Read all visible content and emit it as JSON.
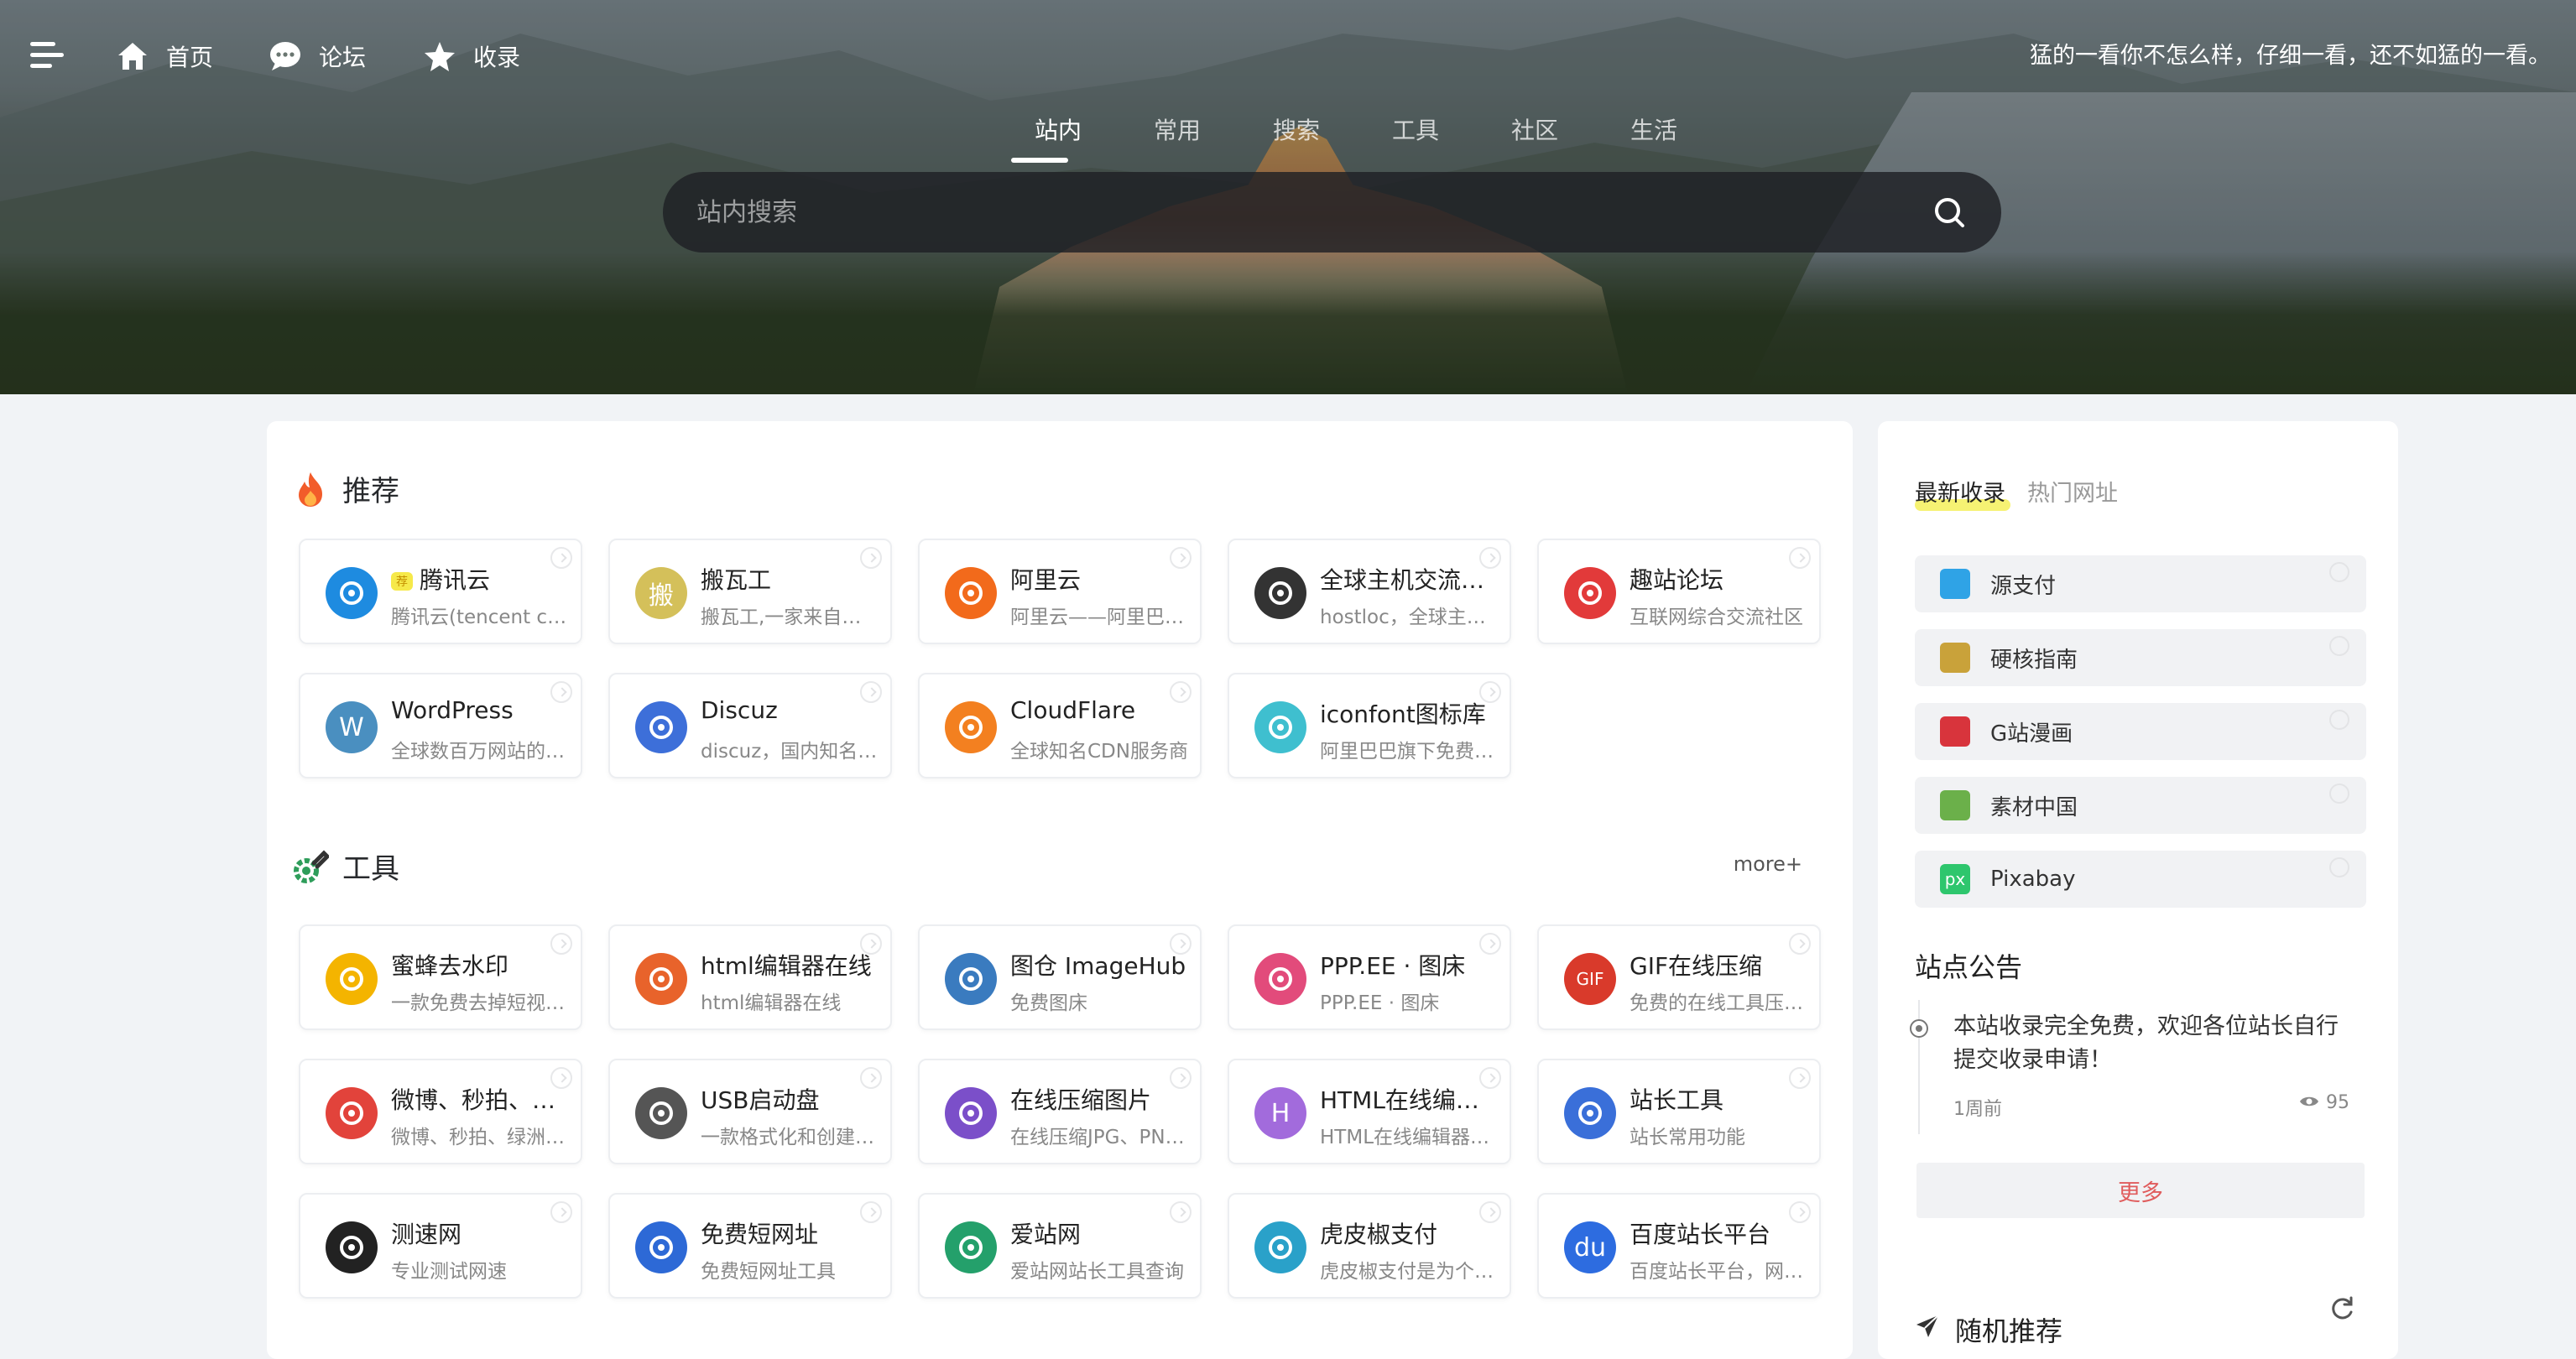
{
  "topnav": {
    "items": [
      {
        "label": "首页",
        "icon": "home-icon"
      },
      {
        "label": "论坛",
        "icon": "chat-icon"
      },
      {
        "label": "收录",
        "icon": "star-icon"
      }
    ],
    "motto": "猛的一看你不怎么样，仔细一看，还不如猛的一看。"
  },
  "search": {
    "tabs": [
      "站内",
      "常用",
      "搜索",
      "工具",
      "社区",
      "生活"
    ],
    "active_tab": "站内",
    "placeholder": "站内搜索"
  },
  "recommend": {
    "title": "推荐",
    "cards": [
      {
        "title": "腾讯云",
        "desc": "腾讯云(tencent cloud)",
        "badge": "荐",
        "icon": "cloud-icon",
        "color": "#1e8be0"
      },
      {
        "title": "搬瓦工",
        "desc": "搬瓦工,一家来自美国的VPS",
        "badge": "",
        "icon": "bwg-icon",
        "glyph": "搬",
        "color": "#d4c05a"
      },
      {
        "title": "阿里云",
        "desc": "阿里云——阿里巴巴集团",
        "badge": "",
        "icon": "aliyun-icon",
        "color": "#f26a1b"
      },
      {
        "title": "全球主机交流论坛",
        "desc": "hostloc，全球主机交流",
        "badge": "",
        "icon": "hostloc-icon",
        "color": "#333333"
      },
      {
        "title": "趣站论坛",
        "desc": "互联网综合交流社区",
        "badge": "",
        "icon": "quzhan-icon",
        "color": "#e23a3a"
      },
      {
        "title": "WordPress",
        "desc": "全球数百万网站的选择",
        "badge": "",
        "icon": "wordpress-icon",
        "glyph": "W",
        "color": "#4a8fc0"
      },
      {
        "title": "Discuz",
        "desc": "discuz，国内知名论坛",
        "badge": "",
        "icon": "discuz-icon",
        "color": "#3d6fd9"
      },
      {
        "title": "CloudFlare",
        "desc": "全球知名CDN服务商",
        "badge": "",
        "icon": "cloudflare-icon",
        "color": "#f38020"
      },
      {
        "title": "iconfont图标库",
        "desc": "阿里巴巴旗下免费图标库",
        "badge": "",
        "icon": "iconfont-icon",
        "color": "#3fbfcf"
      }
    ]
  },
  "tools": {
    "title": "工具",
    "more": "more+",
    "cards": [
      {
        "title": "蜜蜂去水印",
        "desc": "一款免费去掉短视频水印",
        "icon": "bee-icon",
        "color": "#f4b400"
      },
      {
        "title": "html编辑器在线",
        "desc": "html编辑器在线",
        "icon": "html-editor-icon",
        "color": "#e8632b"
      },
      {
        "title": "图仓 ImageHub",
        "desc": "免费图床",
        "icon": "image-icon",
        "color": "#3a7bbf"
      },
      {
        "title": "PPP.EE · 图床",
        "desc": "PPP.EE · 图床",
        "icon": "pinwheel-icon",
        "color": "#e24b7b"
      },
      {
        "title": "GIF在线压缩",
        "desc": "免费的在线工具压缩GIF",
        "icon": "gif-icon",
        "glyph": "GIF",
        "color": "#d93a2b"
      },
      {
        "title": "微博、秒拍、绿洲",
        "desc": "微博、秒拍、绿洲视频下载",
        "icon": "download-icon",
        "color": "#e2433b"
      },
      {
        "title": "USB启动盘",
        "desc": "一款格式化和创建启动盘",
        "icon": "usb-icon",
        "color": "#555555"
      },
      {
        "title": "在线压缩图片",
        "desc": "在线压缩JPG、PNG图片",
        "icon": "compress-icon",
        "color": "#7b4fc9"
      },
      {
        "title": "HTML在线编辑器",
        "desc": "HTML在线编辑器工具",
        "icon": "h-icon",
        "glyph": "H",
        "color": "#a26bdc"
      },
      {
        "title": "站长工具",
        "desc": "站长常用功能",
        "icon": "webmaster-icon",
        "color": "#3a6fd9"
      },
      {
        "title": "测速网",
        "desc": "专业测试网速",
        "icon": "speedometer-icon",
        "color": "#222222"
      },
      {
        "title": "免费短网址",
        "desc": "免费短网址工具",
        "icon": "shorturl-icon",
        "color": "#2d69d6"
      },
      {
        "title": "爱站网",
        "desc": "爱站网站长工具查询",
        "icon": "aizhan-icon",
        "color": "#24a06b"
      },
      {
        "title": "虎皮椒支付",
        "desc": "虎皮椒支付是为个人开发者",
        "icon": "hupijiao-icon",
        "color": "#2aa1c9"
      },
      {
        "title": "百度站长平台",
        "desc": "百度站长平台，网站优化",
        "icon": "baidu-icon",
        "glyph": "du",
        "color": "#2d6ce0"
      }
    ]
  },
  "sidebar": {
    "tabs": [
      "最新收录",
      "热门网址"
    ],
    "items": [
      {
        "label": "源支付",
        "icon": "yuanzhifu-icon",
        "color": "#2fa3e6"
      },
      {
        "label": "硬核指南",
        "icon": "gear-sun-icon",
        "color": "#c9a23a"
      },
      {
        "label": "G站漫画",
        "icon": "gzhan-icon",
        "color": "#d8343c"
      },
      {
        "label": "素材中国",
        "icon": "sucai-icon",
        "color": "#6bb04a"
      },
      {
        "label": "Pixabay",
        "icon": "pixabay-icon",
        "glyph": "px",
        "color": "#2ec66d"
      }
    ],
    "notice": {
      "title": "站点公告",
      "text": "本站收录完全免费，欢迎各位站长自行提交收录申请！",
      "time": "1周前",
      "views": "95",
      "more": "更多"
    },
    "random": {
      "title": "随机推荐"
    }
  }
}
